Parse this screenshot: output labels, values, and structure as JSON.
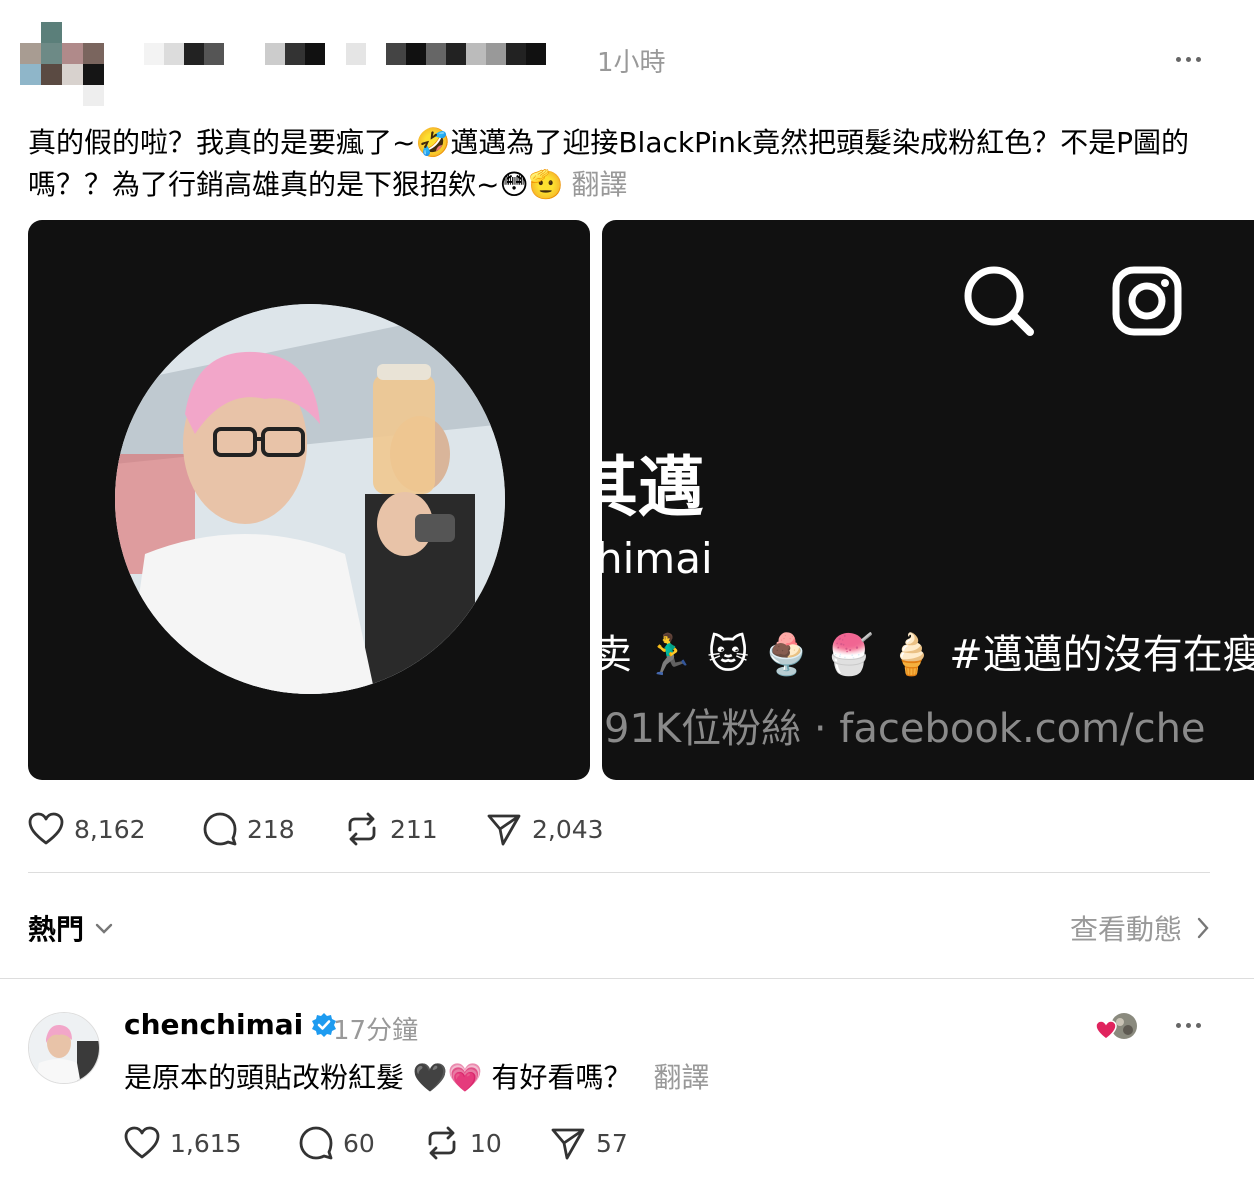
{
  "post": {
    "timestamp": "1小時",
    "text": "真的假的啦？我真的是要瘋了~🤣邁邁為了迎接BlackPink竟然把頭髮染成粉紅色？不是P圖的嗎？？為了行銷高雄真的是下狠招欸~😳🫡",
    "translate_label": "翻譯",
    "media2": {
      "name_partial": "其邁",
      "handle_partial": "himai",
      "bio_partial": "卖 🏃‍♂️ 🐱 🍨 🍧 🍦  #邁邁的沒有在瘦",
      "followers_partial": "91K位粉絲 · facebook.com/che"
    },
    "actions": {
      "likes": "8,162",
      "comments": "218",
      "reposts": "211",
      "shares": "2,043"
    }
  },
  "sort": {
    "label": "熱門",
    "view_activity": "查看動態"
  },
  "reply": {
    "username": "chenchimai",
    "time": "17分鐘",
    "text": "是原本的頭貼改粉紅髮 🖤💗 有好看嗎？",
    "translate_label": "翻譯",
    "actions": {
      "likes": "1,615",
      "comments": "60",
      "reposts": "10",
      "shares": "57"
    }
  },
  "colors": {
    "verified": "#1d9bf0",
    "heart": "#e0245e"
  },
  "icons": [
    "more-icon",
    "heart-icon",
    "comment-icon",
    "repost-icon",
    "share-icon",
    "chevron-down-icon",
    "chevron-right-icon",
    "verified-icon",
    "search-icon",
    "instagram-icon"
  ]
}
